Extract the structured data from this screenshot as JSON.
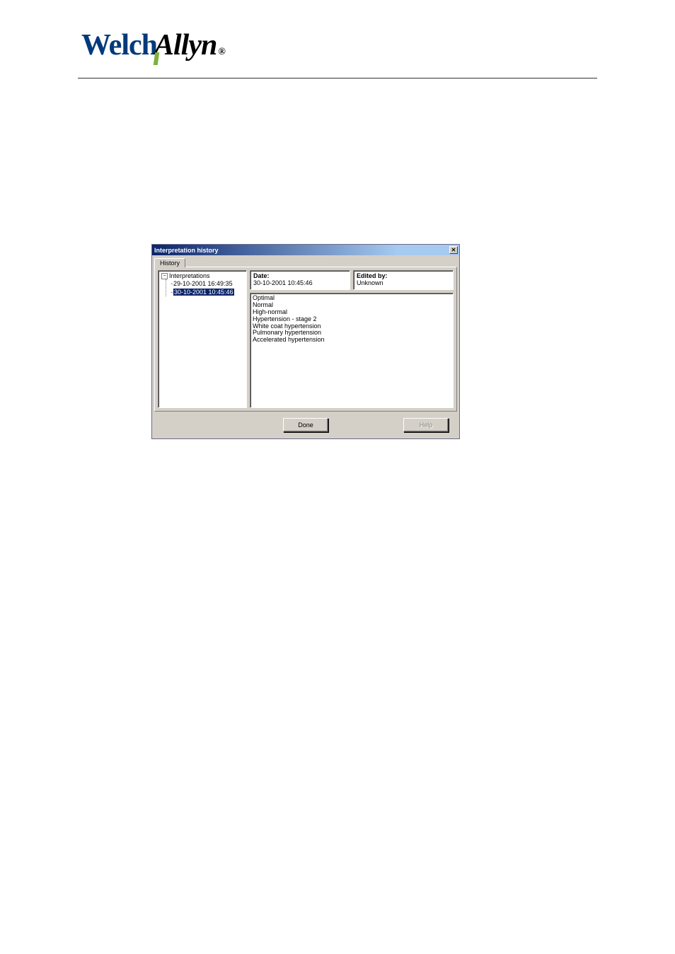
{
  "logo": {
    "part1": "Welch",
    "part2": "Allyn",
    "reg": "®"
  },
  "window": {
    "title": "Interpretation history",
    "tab": "History",
    "tree": {
      "root": "Interpretations",
      "items": [
        "29-10-2001 16:49:35",
        "30-10-2001 10:45:46"
      ]
    },
    "info": {
      "dateLabel": "Date:",
      "dateValue": "30-10-2001 10:45:46",
      "editedLabel": "Edited by:",
      "editedValue": "Unknown"
    },
    "content": [
      "Optimal",
      "Normal",
      "High-normal",
      "Hypertension - stage 2",
      "White coat hypertension",
      "Pulmonary hypertension",
      "Accelerated hypertension"
    ],
    "buttons": {
      "done": "Done",
      "help": "Help"
    }
  }
}
